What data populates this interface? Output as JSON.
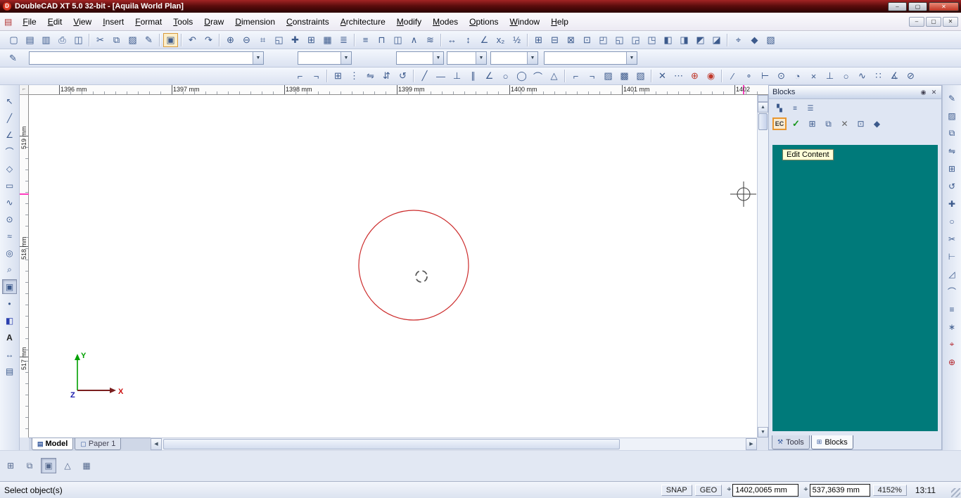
{
  "window": {
    "title": "DoubleCAD XT 5.0 32-bit - [Aquila World Plan]",
    "logo_letter": "D",
    "controls": [
      {
        "name": "minimize-button",
        "glyph": "–"
      },
      {
        "name": "maximize-button",
        "glyph": "▢"
      },
      {
        "name": "close-button",
        "glyph": "✕"
      }
    ]
  },
  "menubar": {
    "document_icon": "▤",
    "items": [
      {
        "name": "menu-file",
        "label": "File"
      },
      {
        "name": "menu-edit",
        "label": "Edit"
      },
      {
        "name": "menu-view",
        "label": "View"
      },
      {
        "name": "menu-insert",
        "label": "Insert"
      },
      {
        "name": "menu-format",
        "label": "Format"
      },
      {
        "name": "menu-tools",
        "label": "Tools"
      },
      {
        "name": "menu-draw",
        "label": "Draw"
      },
      {
        "name": "menu-dimension",
        "label": "Dimension"
      },
      {
        "name": "menu-constraints",
        "label": "Constraints"
      },
      {
        "name": "menu-architecture",
        "label": "Architecture"
      },
      {
        "name": "menu-modify",
        "label": "Modify"
      },
      {
        "name": "menu-modes",
        "label": "Modes"
      },
      {
        "name": "menu-options",
        "label": "Options"
      },
      {
        "name": "menu-window",
        "label": "Window"
      },
      {
        "name": "menu-help",
        "label": "Help"
      }
    ],
    "mdi_controls": [
      {
        "name": "mdi-minimize-button",
        "glyph": "–"
      },
      {
        "name": "mdi-restore-button",
        "glyph": "▢"
      },
      {
        "name": "mdi-close-button",
        "glyph": "✕"
      }
    ]
  },
  "toolbar_main": {
    "icons": [
      {
        "name": "new-icon",
        "glyph": "▢"
      },
      {
        "name": "open-icon",
        "glyph": "▤"
      },
      {
        "name": "save-icon",
        "glyph": "▥"
      },
      {
        "name": "print-icon",
        "glyph": "⎙"
      },
      {
        "name": "print-preview-icon",
        "glyph": "◫"
      },
      {
        "name": "separator"
      },
      {
        "name": "cut-icon",
        "glyph": "✂"
      },
      {
        "name": "copy-icon",
        "glyph": "⧉"
      },
      {
        "name": "paste-icon",
        "glyph": "▨"
      },
      {
        "name": "format-painter-icon",
        "glyph": "✎"
      },
      {
        "name": "separator"
      },
      {
        "name": "edit-content-tool-icon",
        "glyph": "▣"
      },
      {
        "name": "separator"
      },
      {
        "name": "undo-icon",
        "glyph": "↶"
      },
      {
        "name": "redo-icon",
        "glyph": "↷"
      },
      {
        "name": "separator"
      },
      {
        "name": "zoom-in-icon",
        "glyph": "⊕"
      },
      {
        "name": "zoom-out-icon",
        "glyph": "⊖"
      },
      {
        "name": "zoom-window-icon",
        "glyph": "⌗"
      },
      {
        "name": "zoom-extents-icon",
        "glyph": "◱"
      },
      {
        "name": "pan-icon",
        "glyph": "✚"
      },
      {
        "name": "grid-icon",
        "glyph": "⊞"
      },
      {
        "name": "sheet-icon",
        "glyph": "▦"
      },
      {
        "name": "calculator-icon",
        "glyph": "≣"
      },
      {
        "name": "separator"
      },
      {
        "name": "wall-tool-icon",
        "glyph": "≡"
      },
      {
        "name": "door-tool-icon",
        "glyph": "⊓"
      },
      {
        "name": "window-tool-icon",
        "glyph": "◫"
      },
      {
        "name": "roof-tool-icon",
        "glyph": "∧"
      },
      {
        "name": "stair-tool-icon",
        "glyph": "≋"
      },
      {
        "name": "separator"
      },
      {
        "name": "dimension-horizontal-icon",
        "glyph": "↔"
      },
      {
        "name": "dimension-vertical-icon",
        "glyph": "↕"
      },
      {
        "name": "dimension-angle-icon",
        "glyph": "∠"
      },
      {
        "name": "scale-x2-icon",
        "glyph": "x₂"
      },
      {
        "name": "scale-half-icon",
        "glyph": "½"
      },
      {
        "name": "separator"
      },
      {
        "name": "box-front-icon",
        "glyph": "⊞"
      },
      {
        "name": "box-back-icon",
        "glyph": "⊟"
      },
      {
        "name": "box-left-icon",
        "glyph": "⊠"
      },
      {
        "name": "box-right-icon",
        "glyph": "⊡"
      },
      {
        "name": "box-top-icon",
        "glyph": "◰"
      },
      {
        "name": "box-bottom-icon",
        "glyph": "◱"
      },
      {
        "name": "box-iso-ne-icon",
        "glyph": "◲"
      },
      {
        "name": "box-iso-nw-icon",
        "glyph": "◳"
      },
      {
        "name": "box-iso-se-icon",
        "glyph": "◧"
      },
      {
        "name": "box-iso-sw-icon",
        "glyph": "◨"
      },
      {
        "name": "box-plan-icon",
        "glyph": "◩"
      },
      {
        "name": "box-elevation-icon",
        "glyph": "◪"
      },
      {
        "name": "separator"
      },
      {
        "name": "view-camera-icon",
        "glyph": "⌖"
      },
      {
        "name": "render-settings-icon",
        "glyph": "◆"
      },
      {
        "name": "materials-icon",
        "glyph": "▧"
      }
    ]
  },
  "toolbar_properties": {
    "leading_icon": {
      "name": "property-pen-icon",
      "glyph": "✎"
    },
    "combos": [
      {
        "name": "selector-combo",
        "value": ""
      },
      {
        "name": "layer-combo",
        "value": ""
      },
      {
        "name": "color-combo",
        "value": ""
      },
      {
        "name": "linetype-combo",
        "value": ""
      },
      {
        "name": "lineweight-combo",
        "value": ""
      },
      {
        "name": "linestyle-combo",
        "value": ""
      }
    ]
  },
  "toolbar_snaps": {
    "icons": [
      {
        "name": "group-icon",
        "glyph": "⌐"
      },
      {
        "name": "ungroup-icon",
        "glyph": "¬"
      },
      {
        "name": "separator"
      },
      {
        "name": "array-icon",
        "glyph": "⊞"
      },
      {
        "name": "distribute-icon",
        "glyph": "⋮"
      },
      {
        "name": "mirror-h-icon",
        "glyph": "⇋"
      },
      {
        "name": "mirror-v-icon",
        "glyph": "⇵"
      },
      {
        "name": "rotate-left-icon",
        "glyph": "↺"
      },
      {
        "name": "separator"
      },
      {
        "name": "line-segment-icon",
        "glyph": "╱"
      },
      {
        "name": "construction-line-icon",
        "glyph": "—"
      },
      {
        "name": "perpendicular-icon",
        "glyph": "⊥"
      },
      {
        "name": "parallel-icon",
        "glyph": "∥"
      },
      {
        "name": "angle-line-icon",
        "glyph": "∠"
      },
      {
        "name": "circle-tool2-icon",
        "glyph": "○"
      },
      {
        "name": "ellipse-tool-icon",
        "glyph": "◯"
      },
      {
        "name": "arc-tool2-icon",
        "glyph": "⌒"
      },
      {
        "name": "triangle-tool-icon",
        "glyph": "△"
      },
      {
        "name": "separator"
      },
      {
        "name": "fillet-corner-icon",
        "glyph": "⌐"
      },
      {
        "name": "chamfer-corner-icon",
        "glyph": "¬"
      },
      {
        "name": "hatch-light-icon",
        "glyph": "▨"
      },
      {
        "name": "hatch-cross-icon",
        "glyph": "▩"
      },
      {
        "name": "hatch-dots-icon",
        "glyph": "▧"
      },
      {
        "name": "separator"
      },
      {
        "name": "erase-icon",
        "glyph": "✕"
      },
      {
        "name": "divide-icon",
        "glyph": "⋯"
      },
      {
        "name": "plot-red-icon",
        "glyph": "⊕"
      },
      {
        "name": "target-red-icon",
        "glyph": "◉"
      },
      {
        "name": "separator"
      },
      {
        "name": "snap-free-icon",
        "glyph": "∕"
      },
      {
        "name": "snap-vertex-icon",
        "glyph": "∘"
      },
      {
        "name": "snap-midpoint-icon",
        "glyph": "⊢"
      },
      {
        "name": "snap-center-icon",
        "glyph": "⊙"
      },
      {
        "name": "snap-quadrant-icon",
        "glyph": "◔"
      },
      {
        "name": "snap-intersection-icon",
        "glyph": "×"
      },
      {
        "name": "snap-perpendicular-icon",
        "glyph": "⊥"
      },
      {
        "name": "snap-tangent-icon",
        "glyph": "○"
      },
      {
        "name": "snap-nearest-icon",
        "glyph": "∿"
      },
      {
        "name": "snap-grid-icon",
        "glyph": "∷"
      },
      {
        "name": "snap-angle-icon",
        "glyph": "∡"
      },
      {
        "name": "no-snap-icon",
        "glyph": "⊘"
      }
    ]
  },
  "left_palette": {
    "icons": [
      {
        "name": "select-tool-icon",
        "glyph": "↖"
      },
      {
        "name": "line-tool-icon",
        "glyph": "╱"
      },
      {
        "name": "polyline-tool-icon",
        "glyph": "∠"
      },
      {
        "name": "arc-tool-icon",
        "glyph": "⌒"
      },
      {
        "name": "polygon-tool-icon",
        "glyph": "◇"
      },
      {
        "name": "rectangle-tool-icon",
        "glyph": "▭"
      },
      {
        "name": "curve-tool-icon",
        "glyph": "∿"
      },
      {
        "name": "circle-tool-icon",
        "glyph": "⊙"
      },
      {
        "name": "spline-tool-icon",
        "glyph": "≈"
      },
      {
        "name": "view-tool-icon",
        "glyph": "◎"
      },
      {
        "name": "zoom-tool-icon",
        "glyph": "⌕"
      },
      {
        "name": "block-edit-tool-icon",
        "glyph": "▣"
      },
      {
        "name": "point-tool-icon",
        "glyph": "•"
      },
      {
        "name": "solid-tool-icon",
        "glyph": "◧"
      },
      {
        "name": "text-tool-icon",
        "glyph": "A"
      },
      {
        "name": "dimension-tool-icon",
        "glyph": "↔"
      },
      {
        "name": "layout-tool-icon",
        "glyph": "▤"
      }
    ]
  },
  "right_palette": {
    "icons": [
      {
        "name": "edit-hatch-icon",
        "glyph": "✎"
      },
      {
        "name": "fill-bucket-icon",
        "glyph": "▨"
      },
      {
        "name": "copy-entity-icon",
        "glyph": "⧉"
      },
      {
        "name": "mirror-entity-icon",
        "glyph": "⇋"
      },
      {
        "name": "array-entity-icon",
        "glyph": "⊞"
      },
      {
        "name": "rotate-entity-icon",
        "glyph": "↺"
      },
      {
        "name": "move-entity-icon",
        "glyph": "✚"
      },
      {
        "name": "circle-entity-icon",
        "glyph": "○"
      },
      {
        "name": "trim-entity-icon",
        "glyph": "✂"
      },
      {
        "name": "extend-entity-icon",
        "glyph": "⊢"
      },
      {
        "name": "chamfer-entity-icon",
        "glyph": "◿"
      },
      {
        "name": "fillet-entity-icon",
        "glyph": "⌒"
      },
      {
        "name": "offset-entity-icon",
        "glyph": "≡"
      },
      {
        "name": "explode-entity-icon",
        "glyph": "∗"
      },
      {
        "name": "measure-entity-icon",
        "glyph": "⌖"
      },
      {
        "name": "plot-entity-icon",
        "glyph": "⊕"
      }
    ]
  },
  "canvas": {
    "hruler_labels": [
      "1396 mm",
      "1397 mm",
      "1398 mm",
      "1399 mm",
      "1400 mm",
      "1401 mm",
      "1402"
    ],
    "vruler_labels": [
      "519 mm",
      "518 mm",
      "517 mm"
    ],
    "axis": {
      "x": "X",
      "y": "Y",
      "z": "Z"
    },
    "entity_colors": {
      "circle_stroke": "#cc2b2b",
      "cursor_marker": "#ff3dbf"
    },
    "tabs": [
      {
        "name": "tab-model",
        "icon": "▤",
        "label": "Model"
      },
      {
        "name": "tab-paper1",
        "icon": "▢",
        "label": "Paper 1"
      }
    ]
  },
  "blocks_panel": {
    "title": "Blocks",
    "header_icons": [
      {
        "name": "autohide-pin-icon",
        "glyph": "◉"
      },
      {
        "name": "close-panel-icon",
        "glyph": "✕"
      }
    ],
    "view_icons": [
      {
        "name": "icons-view-icon",
        "glyph": "▚"
      },
      {
        "name": "list-view-icon",
        "glyph": "≡"
      },
      {
        "name": "details-view-icon",
        "glyph": "☰"
      }
    ],
    "action_icons": [
      {
        "name": "edit-content-button",
        "glyph": "EC"
      },
      {
        "name": "finish-edit-icon",
        "glyph": "✓"
      },
      {
        "name": "make-block-icon",
        "glyph": "⊞"
      },
      {
        "name": "insert-block-icon",
        "glyph": "⧉"
      },
      {
        "name": "delete-block-icon",
        "glyph": "✕"
      },
      {
        "name": "copy-block-icon",
        "glyph": "⊡"
      },
      {
        "name": "block-attributes-icon",
        "glyph": "◆"
      }
    ],
    "tooltip": "Edit Content",
    "content_color": "#007a7a",
    "content_style": "background:#007a7a",
    "highlight_color": "#e8962e",
    "tabs": [
      {
        "name": "panel-tab-tools",
        "icon": "⚒",
        "label": "Tools"
      },
      {
        "name": "panel-tab-blocks",
        "icon": "⊞",
        "label": "Blocks"
      }
    ]
  },
  "mini_toolbar": {
    "icons": [
      {
        "name": "wireframe-mode-icon",
        "glyph": "⊞"
      },
      {
        "name": "hidden-line-mode-icon",
        "glyph": "⧉"
      },
      {
        "name": "render-mode-icon",
        "glyph": "▣"
      },
      {
        "name": "draft-mode-icon",
        "glyph": "△"
      },
      {
        "name": "quality-mode-icon",
        "glyph": "▦"
      }
    ]
  },
  "statusbar": {
    "message": "Select object(s)",
    "snap_label": "SNAP",
    "geo_label": "GEO",
    "x_icon": "⌖",
    "x_value": "1402,0065 mm",
    "y_icon": "⌖",
    "y_value": "537,3639 mm",
    "zoom": "4152%",
    "time": "13:11"
  }
}
